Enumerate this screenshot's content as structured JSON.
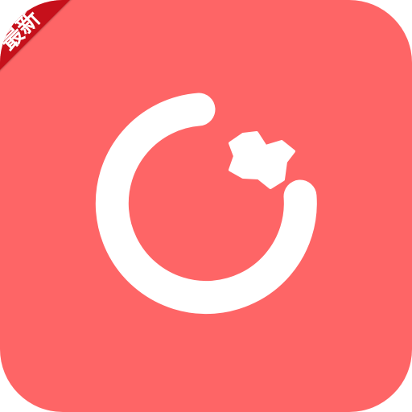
{
  "app_icon": {
    "background_color": "#fe6566",
    "glyph_color": "#ffffff",
    "glyph_icon": "crescent-star-icon"
  },
  "badge": {
    "text": "最新",
    "color": "#c6101b",
    "text_color": "#ffffff"
  }
}
